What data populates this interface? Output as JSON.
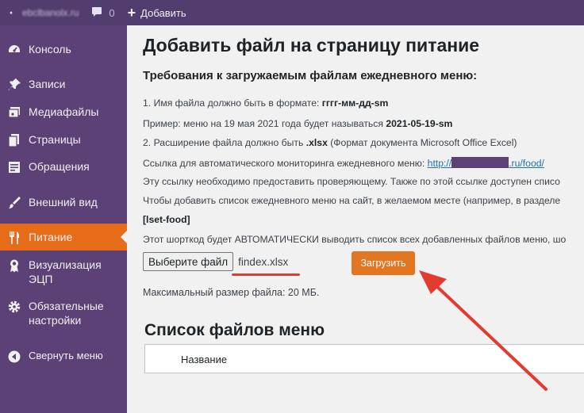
{
  "adminbar": {
    "site_name": "ebclbanolx.ru",
    "comments_count": "0",
    "new_label": "Добавить"
  },
  "sidebar": {
    "items": [
      {
        "label": "Консоль",
        "icon": "dashboard-icon"
      },
      {
        "label": "Записи",
        "icon": "pin-icon"
      },
      {
        "label": "Медиафайлы",
        "icon": "media-icon"
      },
      {
        "label": "Страницы",
        "icon": "pages-icon"
      },
      {
        "label": "Обращения",
        "icon": "form-icon"
      },
      {
        "label": "Внешний вид",
        "icon": "brush-icon"
      },
      {
        "label": "Питание",
        "icon": "utensils-icon",
        "active": true
      },
      {
        "label": "Визуализация ЭЦП",
        "icon": "badge-icon"
      },
      {
        "label": "Обязательные настройки",
        "icon": "gear-icon"
      },
      {
        "label": "Свернуть меню",
        "icon": "collapse-icon"
      }
    ]
  },
  "main": {
    "title": "Добавить файл на страницу питание",
    "subtitle": "Требования к загружаемым файлам ежедневного меню:",
    "line1_num": "1.",
    "line1_text": "Имя файла должно быть в формате:",
    "line1_format": "гггг-мм-дд-sm",
    "line2_text": "Пример: меню на 19 мая 2021 года будет называться",
    "line2_example": "2021-05-19-sm",
    "line3_num": "2.",
    "line3_text": "Расширение файла должно быть",
    "line3_ext": ".xlsx",
    "line3_note": "(Формат документа Microsoft Office Excel)",
    "line4_text": "Ссылка для автоматического мониторинга ежедневного меню:",
    "line4_link_start": "http://",
    "line4_link_end": ".ru/food/",
    "line5_text": "Эту ссылку необходимо предоставить проверяющему. Также по этой ссылке доступен списо",
    "line6_text": "Чтобы добавить список ежедневного меню на сайт, в желаемом месте (например, в разделе",
    "shortcode": "[lset-food]",
    "line7_text": "Этот шорткод будет АВТОМАТИЧЕСКИ выводить список всех добавленных файлов меню, шо",
    "file_button": "Выберите файл",
    "file_name": "findex.xlsx",
    "upload_button": "Загрузить",
    "max_size": "Максимальный размер файла: 20 МБ.",
    "list_title": "Список файлов меню",
    "table_header": "Название"
  },
  "colors": {
    "adminbar": "#533c6e",
    "sidebar": "#5b4175",
    "active": "#e56d1a",
    "upload_button": "#e27621",
    "annotation": "#e23b2f",
    "link": "#2271b1"
  }
}
